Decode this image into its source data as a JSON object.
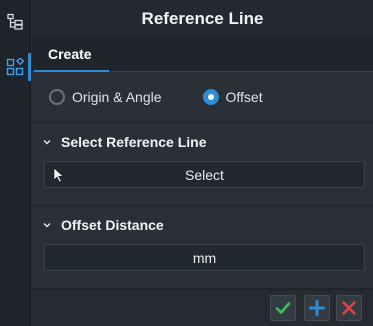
{
  "window": {
    "title": "Reference Line"
  },
  "sidebar": {
    "icons": [
      "tree-icon",
      "component-grid-icon"
    ]
  },
  "tabs": [
    {
      "label": "Create",
      "active": true
    }
  ],
  "mode": {
    "options": [
      {
        "label": "Origin & Angle",
        "checked": false
      },
      {
        "label": "Offset",
        "checked": true
      }
    ]
  },
  "select_reference": {
    "title": "Select Reference Line",
    "button_label": "Select"
  },
  "offset_distance": {
    "title": "Offset Distance",
    "value": "",
    "unit": "mm"
  },
  "footer": {
    "buttons": [
      "ok",
      "add",
      "cancel"
    ]
  },
  "colors": {
    "accent": "#2f8bd6",
    "ok": "#3fbf5a",
    "add": "#2f8bd6",
    "cancel": "#e04545"
  }
}
